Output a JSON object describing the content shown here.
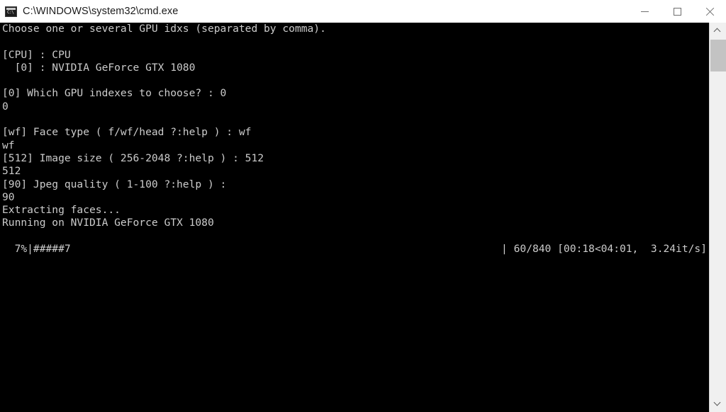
{
  "window": {
    "title": "C:\\WINDOWS\\system32\\cmd.exe",
    "icon": "cmd-console-icon",
    "controls": {
      "minimize_label": "Minimize",
      "maximize_label": "Maximize",
      "close_label": "Close"
    },
    "titlebar_bg": "#ffffff",
    "console_bg": "#000000",
    "console_fg": "#cccccc"
  },
  "console": {
    "lines": [
      "Choose one or several GPU idxs (separated by comma).",
      "",
      "[CPU] : CPU",
      "  [0] : NVIDIA GeForce GTX 1080",
      "",
      "[0] Which GPU indexes to choose? : 0",
      "0",
      "",
      "[wf] Face type ( f/wf/head ?:help ) : wf",
      "wf",
      "[512] Image size ( 256-2048 ?:help ) : 512",
      "512",
      "[90] Jpeg quality ( 1-100 ?:help ) :",
      "90",
      "Extracting faces...",
      "Running on NVIDIA GeForce GTX 1080"
    ],
    "progress": {
      "bar": "  7%|#####7",
      "percent": 7,
      "stats": "| 60/840 [00:18<04:01,  3.24it/s]",
      "current": 60,
      "total": 840,
      "elapsed": "00:18",
      "remaining": "04:01",
      "rate": "3.24it/s"
    }
  },
  "scrollbar": {
    "up_arrow": "chevron-up-icon",
    "down_arrow": "chevron-down-icon",
    "thumb_color": "#c3c3c3",
    "track_color": "#f0f0f0"
  }
}
